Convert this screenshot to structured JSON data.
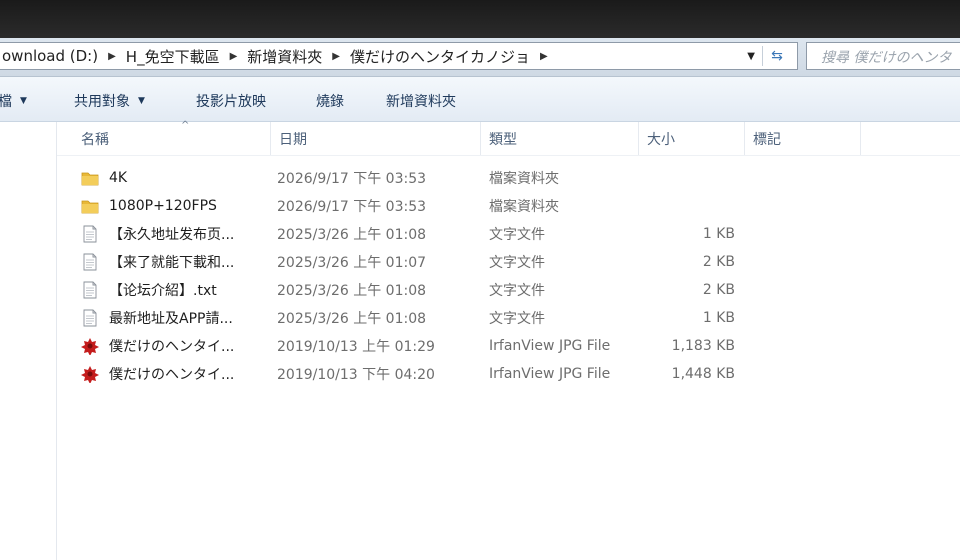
{
  "address": {
    "crumbs": [
      "ownload (D:)",
      "H_免空下載區",
      "新增資料夾",
      "僕だけのヘンタイカノジョ"
    ],
    "search_placeholder": "搜尋 僕だけのヘンタ"
  },
  "toolbar": {
    "organize_label": "檔",
    "share_label": "共用對象",
    "slideshow_label": "投影片放映",
    "burn_label": "燒錄",
    "new_folder_label": "新增資料夾"
  },
  "columns": {
    "name": "名稱",
    "date": "日期",
    "type": "類型",
    "size": "大小",
    "tags": "標記"
  },
  "files": [
    {
      "name": "4K",
      "date": "2026/9/17 下午 03:53",
      "type": "檔案資料夾",
      "size": "",
      "icon": "folder-icon"
    },
    {
      "name": "1080P+120FPS",
      "date": "2026/9/17 下午 03:53",
      "type": "檔案資料夾",
      "size": "",
      "icon": "folder-icon"
    },
    {
      "name": "【永久地址发布页...",
      "date": "2025/3/26 上午 01:08",
      "type": "文字文件",
      "size": "1 KB",
      "icon": "text-file-icon"
    },
    {
      "name": "【来了就能下載和...",
      "date": "2025/3/26 上午 01:07",
      "type": "文字文件",
      "size": "2 KB",
      "icon": "text-file-icon"
    },
    {
      "name": "【论坛介紹】.txt",
      "date": "2025/3/26 上午 01:08",
      "type": "文字文件",
      "size": "2 KB",
      "icon": "text-file-icon"
    },
    {
      "name": "最新地址及APP請...",
      "date": "2025/3/26 上午 01:08",
      "type": "文字文件",
      "size": "1 KB",
      "icon": "text-file-icon"
    },
    {
      "name": "僕だけのヘンタイ...",
      "date": "2019/10/13 上午 01:29",
      "type": "IrfanView JPG File",
      "size": "1,183 KB",
      "icon": "irfanview-image-icon"
    },
    {
      "name": "僕だけのヘンタイ...",
      "date": "2019/10/13 下午 04:20",
      "type": "IrfanView JPG File",
      "size": "1,448 KB",
      "icon": "irfanview-image-icon"
    }
  ],
  "colors": {
    "toolbar_text": "#1e395b",
    "folder": "#e8b838",
    "irfanview": "#c41c1c"
  }
}
